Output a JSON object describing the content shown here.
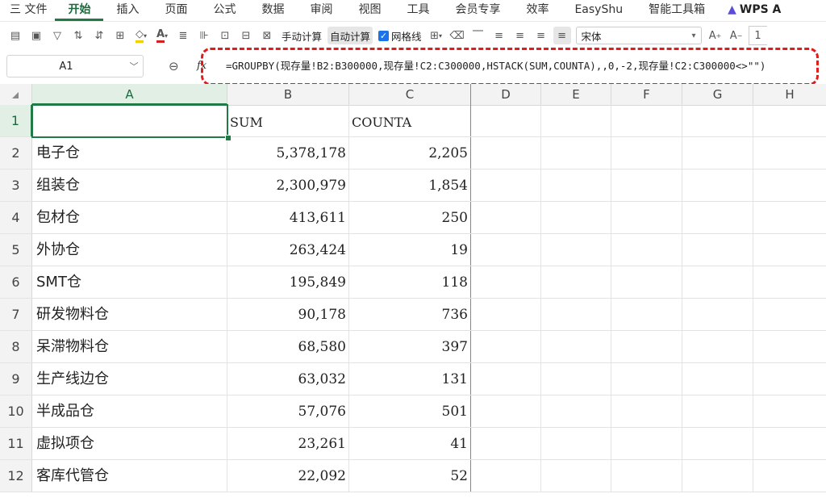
{
  "menu": [
    "三 文件",
    "开始",
    "插入",
    "页面",
    "公式",
    "数据",
    "审阅",
    "视图",
    "工具",
    "会员专享",
    "效率",
    "EasyShu",
    "智能工具箱",
    "WPS A"
  ],
  "active_menu_index": 1,
  "toolbar": {
    "manual_calc": "手动计算",
    "auto_calc": "自动计算",
    "gridlines": "网格线",
    "font_name": "宋体"
  },
  "namebox": "A1",
  "formula": "=GROUPBY(现存量!B2:B300000,现存量!C2:C300000,HSTACK(SUM,COUNTA),,0,-2,现存量!C2:C300000<>\"\")",
  "columns": [
    "A",
    "B",
    "C",
    "D",
    "E",
    "F",
    "G",
    "H"
  ],
  "table": {
    "header": [
      "",
      "SUM",
      "COUNTA"
    ],
    "rows": [
      {
        "num": "1"
      },
      {
        "num": "2",
        "name": "电子仓",
        "sum": "5,378,178",
        "count": "2,205"
      },
      {
        "num": "3",
        "name": "组装仓",
        "sum": "2,300,979",
        "count": "1,854"
      },
      {
        "num": "4",
        "name": "包材仓",
        "sum": "413,611",
        "count": "250"
      },
      {
        "num": "5",
        "name": "外协仓",
        "sum": "263,424",
        "count": "19"
      },
      {
        "num": "6",
        "name": "SMT仓",
        "sum": "195,849",
        "count": "118"
      },
      {
        "num": "7",
        "name": "研发物料仓",
        "sum": "90,178",
        "count": "736"
      },
      {
        "num": "8",
        "name": "呆滞物料仓",
        "sum": "68,580",
        "count": "397"
      },
      {
        "num": "9",
        "name": "生产线边仓",
        "sum": "63,032",
        "count": "131"
      },
      {
        "num": "10",
        "name": "半成品仓",
        "sum": "57,076",
        "count": "501"
      },
      {
        "num": "11",
        "name": "虚拟项仓",
        "sum": "23,261",
        "count": "41"
      },
      {
        "num": "12",
        "name": "客库代管仓",
        "sum": "22,092",
        "count": "52"
      }
    ]
  }
}
